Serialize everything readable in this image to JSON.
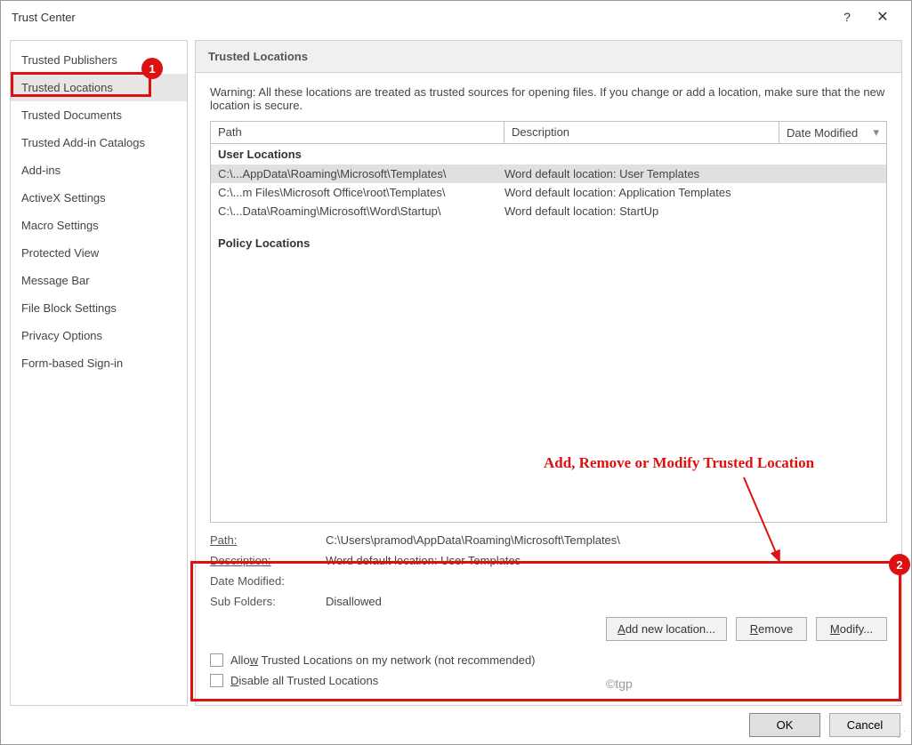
{
  "titlebar": {
    "title": "Trust Center"
  },
  "sidebar": {
    "items": [
      {
        "label": "Trusted Publishers"
      },
      {
        "label": "Trusted Locations"
      },
      {
        "label": "Trusted Documents"
      },
      {
        "label": "Trusted Add-in Catalogs"
      },
      {
        "label": "Add-ins"
      },
      {
        "label": "ActiveX Settings"
      },
      {
        "label": "Macro Settings"
      },
      {
        "label": "Protected View"
      },
      {
        "label": "Message Bar"
      },
      {
        "label": "File Block Settings"
      },
      {
        "label": "Privacy Options"
      },
      {
        "label": "Form-based Sign-in"
      }
    ]
  },
  "content": {
    "section_title": "Trusted Locations",
    "warning": "Warning: All these locations are treated as trusted sources for opening files.  If you change or add a location, make sure that the new location is secure.",
    "columns": {
      "path": "Path",
      "description": "Description",
      "date": "Date Modified"
    },
    "groups": {
      "user": "User Locations",
      "policy": "Policy Locations"
    },
    "rows": [
      {
        "path": "C:\\...AppData\\Roaming\\Microsoft\\Templates\\",
        "desc": "Word default location: User Templates"
      },
      {
        "path": "C:\\...m Files\\Microsoft Office\\root\\Templates\\",
        "desc": "Word default location: Application Templates"
      },
      {
        "path": "C:\\...Data\\Roaming\\Microsoft\\Word\\Startup\\",
        "desc": "Word default location: StartUp"
      }
    ],
    "details": {
      "path_label": "Path:",
      "path_value": "C:\\Users\\pramod\\AppData\\Roaming\\Microsoft\\Templates\\",
      "desc_label": "Description:",
      "desc_value": "Word default location: User Templates",
      "date_label": "Date Modified:",
      "date_value": "",
      "sub_label": "Sub Folders:",
      "sub_value": "Disallowed"
    },
    "buttons": {
      "add": "Add new location...",
      "remove": "Remove",
      "modify": "Modify..."
    },
    "checks": {
      "network": "Allow Trusted Locations on my network (not recommended)",
      "disable": "Disable all Trusted Locations"
    }
  },
  "footer": {
    "ok": "OK",
    "cancel": "Cancel"
  },
  "annotations": {
    "callout": "Add, Remove or Modify Trusted Location",
    "watermark": "©tgp",
    "badge1": "1",
    "badge2": "2"
  }
}
